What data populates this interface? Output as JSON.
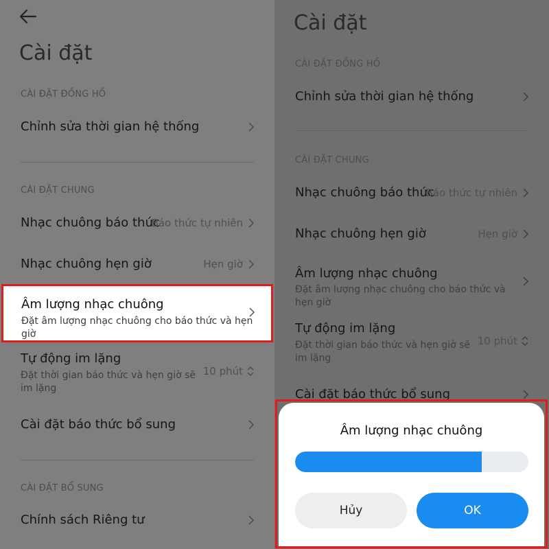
{
  "left": {
    "title": "Cài đặt",
    "section_clock": "CÀI ĐẶT ĐỒNG HỒ",
    "edit_time": "Chỉnh sửa thời gian hệ thống",
    "section_general": "CÀI ĐẶT CHUNG",
    "alarm_ringtone": {
      "label": "Nhạc chuông báo thức",
      "value": "Báo thức tự nhiên"
    },
    "timer_ringtone": {
      "label": "Nhạc chuông hẹn giờ",
      "value": "Hẹn giờ"
    },
    "ringtone_volume": {
      "label": "Âm lượng nhạc chuông",
      "sub": "Đặt âm lượng nhạc chuông cho báo thức và hẹn giờ"
    },
    "auto_silence": {
      "label": "Tự động im lặng",
      "sub": "Đặt thời gian báo thức và hẹn giờ sẽ im lặng",
      "value": "10 phút"
    },
    "extra_alarm": "Cài đặt báo thức bổ sung",
    "section_extra": "CÀI ĐẶT BỔ SUNG",
    "privacy": "Chính sách Riêng tư"
  },
  "right": {
    "title": "Cài đặt",
    "section_clock": "CÀI ĐẶT ĐỒNG HỒ",
    "edit_time": "Chỉnh sửa thời gian hệ thống",
    "section_general": "CÀI ĐẶT CHUNG",
    "alarm_ringtone": {
      "label": "Nhạc chuông báo thức",
      "value": "Báo thức tự nhiên"
    },
    "timer_ringtone": {
      "label": "Nhạc chuông hẹn giờ",
      "value": "Hẹn giờ"
    },
    "ringtone_volume": {
      "label": "Âm lượng nhạc chuông",
      "sub": "Đặt âm lượng nhạc chuông cho báo thức và hẹn giờ"
    },
    "auto_silence": {
      "label": "Tự động im lặng",
      "sub": "Đặt thời gian báo thức và hẹn giờ sẽ im lặng",
      "value": "10 phút"
    },
    "extra_alarm": "Cài đặt báo thức bổ sung"
  },
  "dialog": {
    "title": "Âm lượng nhạc chuông",
    "volume_fraction": 0.8,
    "cancel_label": "Hủy",
    "ok_label": "OK"
  },
  "colors": {
    "accent": "#1a8cf0",
    "highlight_border": "#e31b1b",
    "dim_overlay": "#7f7f7f"
  },
  "icons": {
    "back": "arrow-left-icon",
    "chevron": "chevron-right-icon",
    "stepper": "chevron-up-down-icon"
  }
}
